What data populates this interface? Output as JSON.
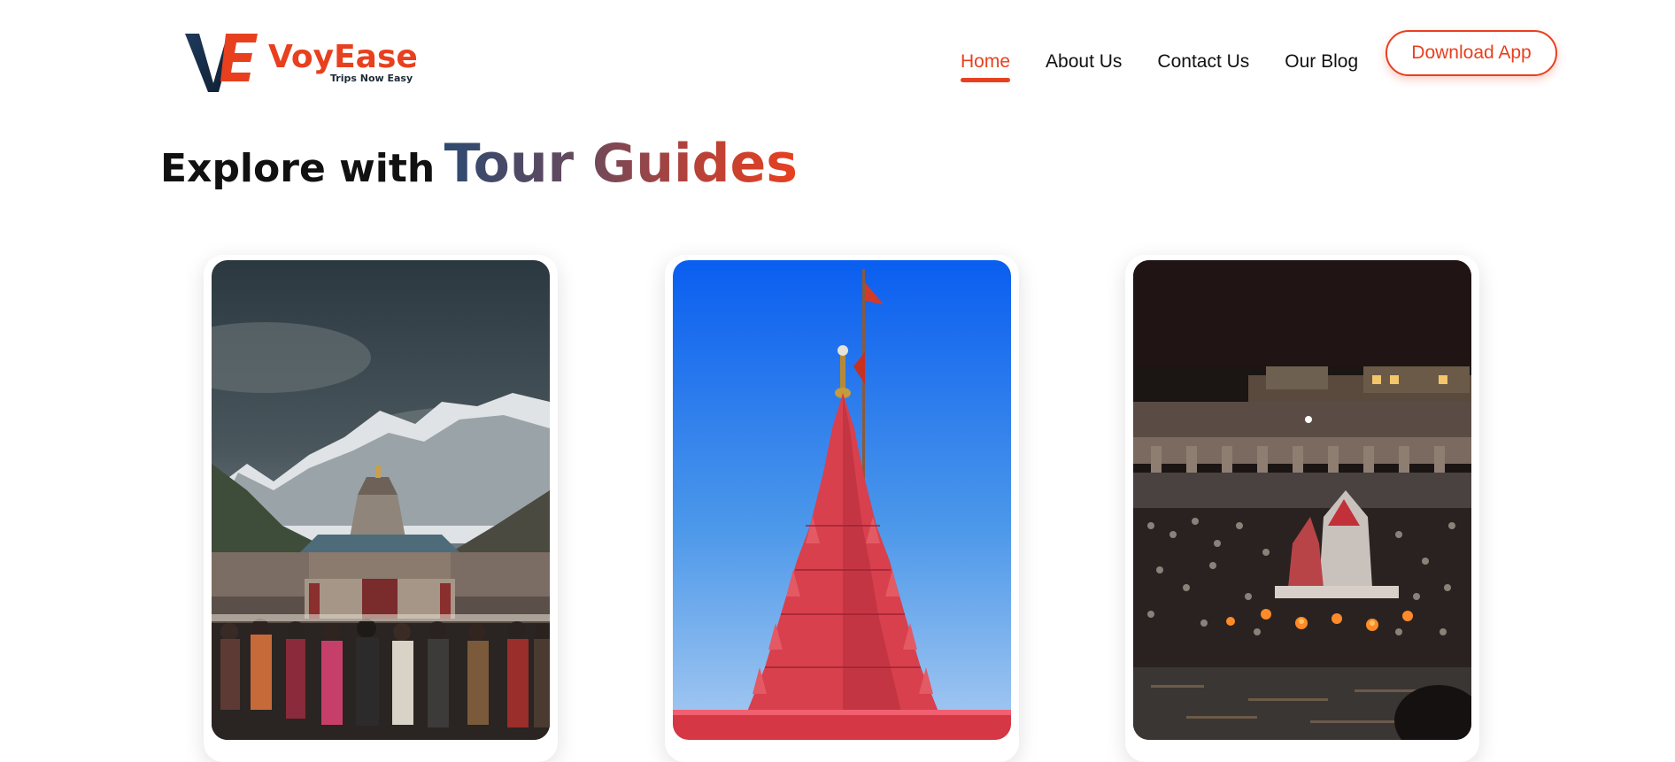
{
  "header": {
    "logo": {
      "name": "VoyEase",
      "tagline": "Trips Now Easy",
      "mark_letters": "VE",
      "mark_small_text": "Ease"
    },
    "nav": [
      {
        "label": "Home",
        "active": true
      },
      {
        "label": "About Us",
        "active": false
      },
      {
        "label": "Contact Us",
        "active": false
      },
      {
        "label": "Our Blog",
        "active": false
      }
    ],
    "download_button": "Download App"
  },
  "hero": {
    "heading_prefix": "Explore with",
    "heading_highlight": "Tour Guides"
  },
  "cards": [
    {
      "image": "kedarnath-temple-mountains-crowd-photo"
    },
    {
      "image": "red-temple-spire-flag-blue-sky-photo"
    },
    {
      "image": "ghat-evening-aarti-crowd-river-photo"
    }
  ],
  "colors": {
    "accent": "#e8401f",
    "navy": "#1e2a38",
    "gradient_start": "#2d4a70",
    "gradient_end": "#e8401f"
  }
}
